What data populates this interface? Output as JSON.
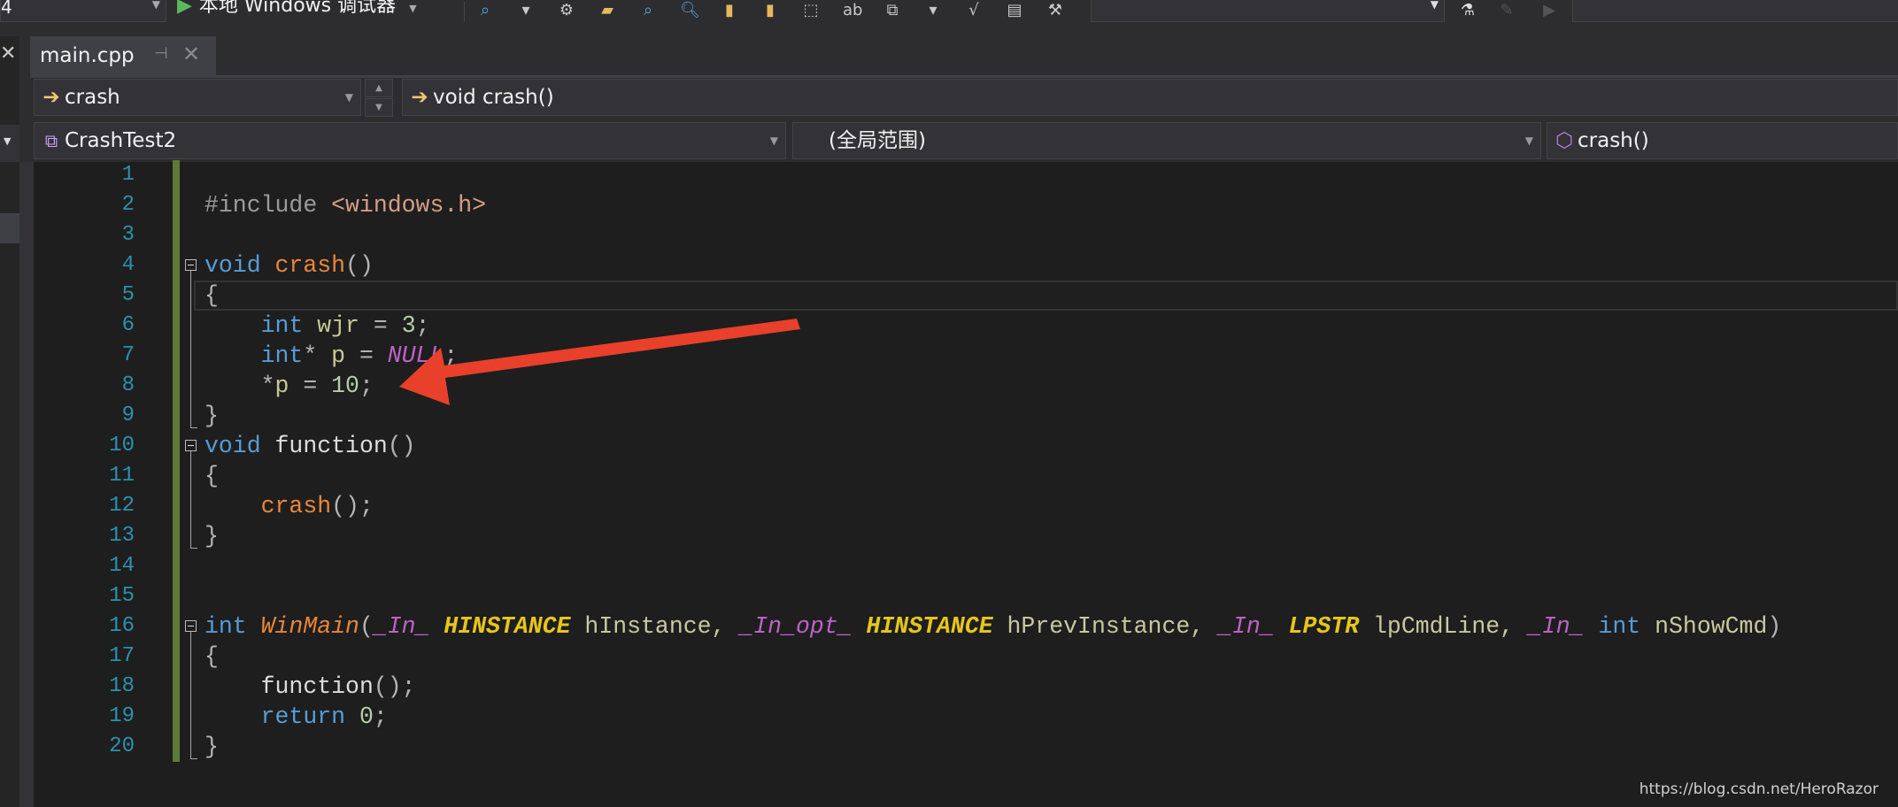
{
  "toolbar": {
    "config_value": "4",
    "debugger_label": "本地 Windows 调试器",
    "icons": [
      "find-icon",
      "dropdown-icon",
      "build-icon",
      "folder-icon",
      "find-files-icon",
      "search-icon",
      "bookmark-icon",
      "bookmark-next-icon",
      "select-icon",
      "spell-icon",
      "copy-icon",
      "dropdown-icon",
      "check-icon",
      "format-icon",
      "tools-icon"
    ]
  },
  "tab": {
    "label": "main.cpp",
    "pin": "⊣",
    "close": "✕"
  },
  "nav": {
    "member_combo": "crash",
    "signature_combo": "void crash()",
    "project_combo": "CrashTest2",
    "scope_combo": "(全局范围)",
    "function_combo": "crash()"
  },
  "code_lines": [
    [],
    [
      {
        "t": "#include ",
        "c": "pp"
      },
      {
        "t": "<windows.h>",
        "c": "str"
      }
    ],
    [],
    [
      {
        "t": "void",
        "c": "kw"
      },
      {
        "t": " ",
        "c": "plain"
      },
      {
        "t": "crash",
        "c": "fn"
      },
      {
        "t": "()",
        "c": "pun"
      }
    ],
    [
      {
        "t": "{",
        "c": "pun"
      }
    ],
    [
      {
        "t": "    ",
        "c": "plain"
      },
      {
        "t": "int",
        "c": "kw"
      },
      {
        "t": " ",
        "c": "plain"
      },
      {
        "t": "wjr",
        "c": "var"
      },
      {
        "t": " = ",
        "c": "pun"
      },
      {
        "t": "3",
        "c": "num"
      },
      {
        "t": ";",
        "c": "pun"
      }
    ],
    [
      {
        "t": "    ",
        "c": "plain"
      },
      {
        "t": "int",
        "c": "kw"
      },
      {
        "t": "* ",
        "c": "pun"
      },
      {
        "t": "p",
        "c": "var"
      },
      {
        "t": " = ",
        "c": "pun"
      },
      {
        "t": "NULL",
        "c": "nul"
      },
      {
        "t": ";",
        "c": "pun"
      }
    ],
    [
      {
        "t": "    ",
        "c": "plain"
      },
      {
        "t": "*",
        "c": "pun"
      },
      {
        "t": "p",
        "c": "var"
      },
      {
        "t": " = ",
        "c": "pun"
      },
      {
        "t": "10",
        "c": "num"
      },
      {
        "t": ";",
        "c": "pun"
      }
    ],
    [
      {
        "t": "}",
        "c": "pun"
      }
    ],
    [
      {
        "t": "void",
        "c": "kw"
      },
      {
        "t": " ",
        "c": "plain"
      },
      {
        "t": "function",
        "c": "plain"
      },
      {
        "t": "()",
        "c": "pun"
      }
    ],
    [
      {
        "t": "{",
        "c": "pun"
      }
    ],
    [
      {
        "t": "    ",
        "c": "plain"
      },
      {
        "t": "crash",
        "c": "fn"
      },
      {
        "t": "();",
        "c": "pun"
      }
    ],
    [
      {
        "t": "}",
        "c": "pun"
      }
    ],
    [],
    [],
    [
      {
        "t": "int",
        "c": "kw"
      },
      {
        "t": " ",
        "c": "plain"
      },
      {
        "t": "WinMain",
        "c": "fni"
      },
      {
        "t": "(",
        "c": "pun"
      },
      {
        "t": "_In_",
        "c": "mac"
      },
      {
        "t": " ",
        "c": "plain"
      },
      {
        "t": "HINSTANCE",
        "c": "typ"
      },
      {
        "t": " hInstance, ",
        "c": "par"
      },
      {
        "t": "_In_opt_",
        "c": "mac"
      },
      {
        "t": " ",
        "c": "plain"
      },
      {
        "t": "HINSTANCE",
        "c": "typ"
      },
      {
        "t": " hPrevInstance, ",
        "c": "par"
      },
      {
        "t": "_In_",
        "c": "mac"
      },
      {
        "t": " ",
        "c": "plain"
      },
      {
        "t": "LPSTR",
        "c": "typ"
      },
      {
        "t": " lpCmdLine, ",
        "c": "par"
      },
      {
        "t": "_In_",
        "c": "mac"
      },
      {
        "t": " ",
        "c": "plain"
      },
      {
        "t": "int",
        "c": "kw"
      },
      {
        "t": " nShowCmd",
        "c": "par"
      },
      {
        "t": ")",
        "c": "pun"
      }
    ],
    [
      {
        "t": "{",
        "c": "pun"
      }
    ],
    [
      {
        "t": "    ",
        "c": "plain"
      },
      {
        "t": "function",
        "c": "plain"
      },
      {
        "t": "();",
        "c": "pun"
      }
    ],
    [
      {
        "t": "    ",
        "c": "plain"
      },
      {
        "t": "return",
        "c": "kw"
      },
      {
        "t": " ",
        "c": "plain"
      },
      {
        "t": "0",
        "c": "num"
      },
      {
        "t": ";",
        "c": "pun"
      }
    ],
    [
      {
        "t": "}",
        "c": "pun"
      }
    ]
  ],
  "fold_starts": [
    4,
    10,
    16
  ],
  "annotation": {
    "color": "#e8402a",
    "points_to_line": 8
  },
  "watermark": "https://blog.csdn.net/HeroRazor"
}
